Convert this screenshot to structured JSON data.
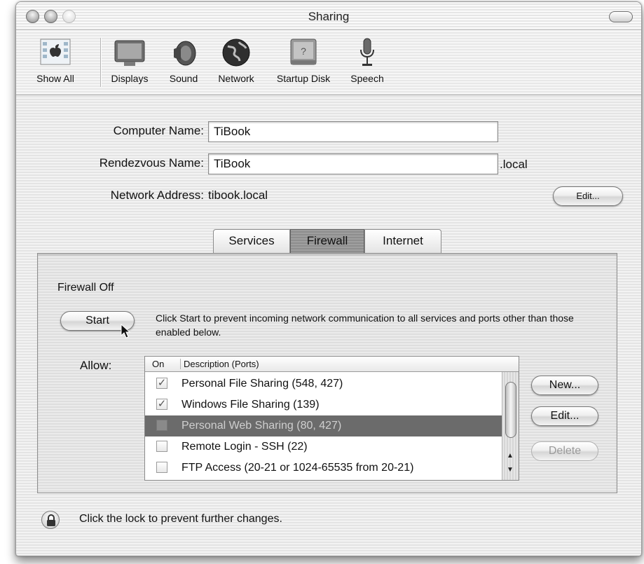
{
  "window": {
    "title": "Sharing"
  },
  "toolbar": {
    "items": [
      {
        "label": "Show All",
        "icon": "apple-menu-icon"
      },
      {
        "label": "Displays",
        "icon": "display-icon"
      },
      {
        "label": "Sound",
        "icon": "speaker-icon"
      },
      {
        "label": "Network",
        "icon": "globe-icon"
      },
      {
        "label": "Startup Disk",
        "icon": "hard-disk-icon"
      },
      {
        "label": "Speech",
        "icon": "microphone-icon"
      }
    ]
  },
  "form": {
    "computer_name_label": "Computer Name:",
    "computer_name_value": "TiBook",
    "rendezvous_label": "Rendezvous Name:",
    "rendezvous_value": "TiBook",
    "rendezvous_suffix": ".local",
    "network_address_label": "Network Address:",
    "network_address_value": "tibook.local",
    "edit_button": "Edit..."
  },
  "tabs": [
    {
      "label": "Services",
      "active": false
    },
    {
      "label": "Firewall",
      "active": true
    },
    {
      "label": "Internet",
      "active": false
    }
  ],
  "firewall": {
    "status": "Firewall Off",
    "start_button": "Start",
    "description": "Click Start to prevent incoming network communication to all services and ports other than those enabled below.",
    "allow_label": "Allow:",
    "columns": {
      "on": "On",
      "description": "Description (Ports)"
    },
    "rows": [
      {
        "on": true,
        "text": "Personal File Sharing (548, 427)",
        "selected": false
      },
      {
        "on": true,
        "text": "Windows File Sharing (139)",
        "selected": false
      },
      {
        "on": false,
        "text": "Personal Web Sharing (80, 427)",
        "selected": true
      },
      {
        "on": false,
        "text": "Remote Login - SSH (22)",
        "selected": false
      },
      {
        "on": false,
        "text": "FTP Access (20-21 or 1024-65535 from 20-21)",
        "selected": false
      }
    ],
    "new_button": "New...",
    "edit_button": "Edit...",
    "delete_button": "Delete",
    "check_glyph": "✓"
  },
  "lock": {
    "text": "Click the lock to prevent further changes."
  }
}
